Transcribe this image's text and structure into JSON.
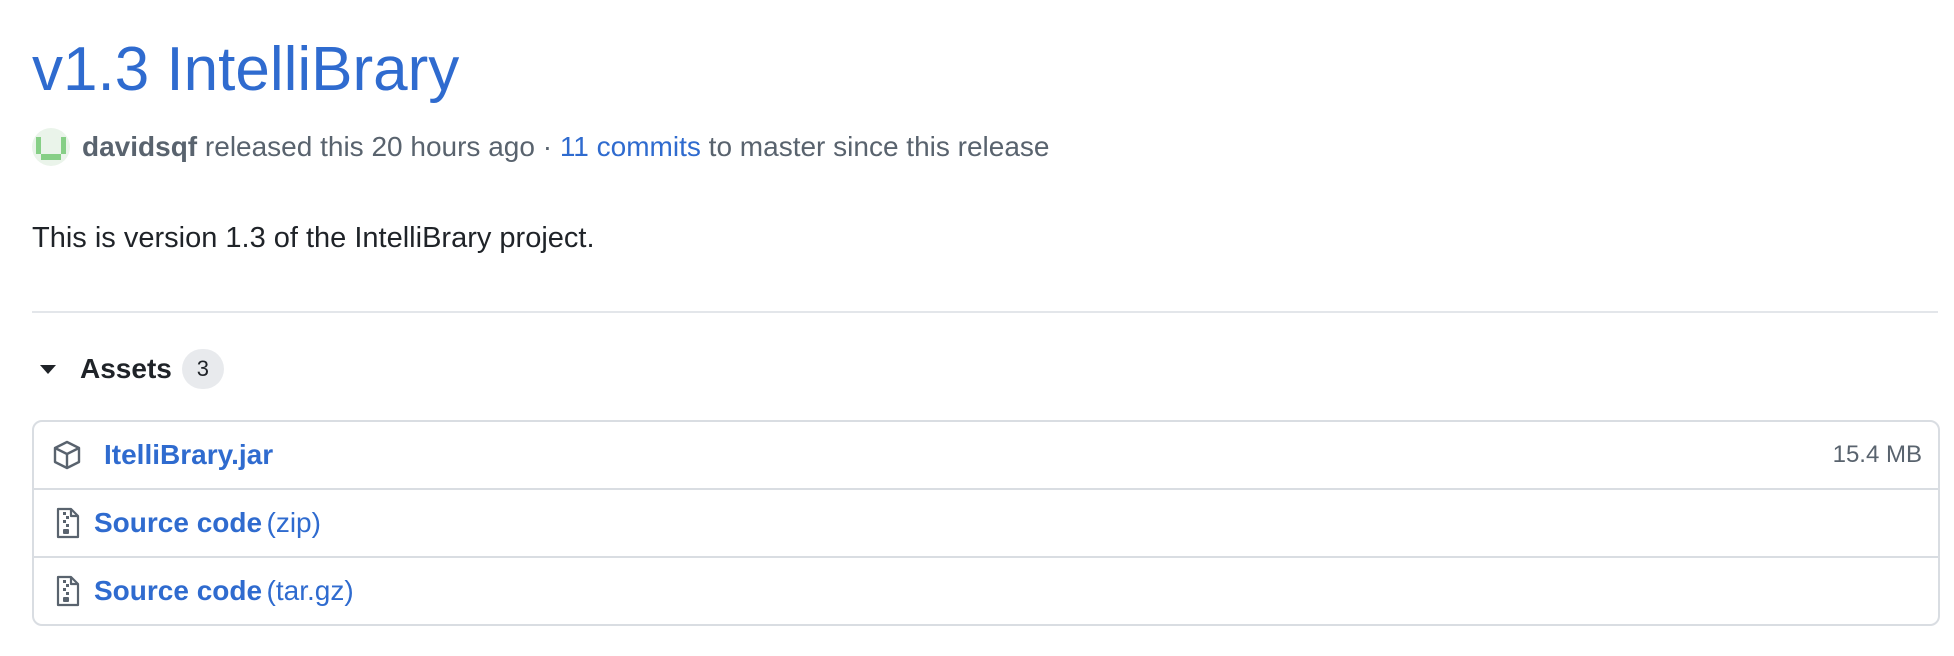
{
  "release": {
    "title": "v1.3 IntelliBrary",
    "author": "davidsqf",
    "released_text": "released this 20 hours ago",
    "separator": "·",
    "commits_link": "11 commits",
    "commits_suffix": "to master since this release",
    "description": "This is version 1.3 of the IntelliBrary project."
  },
  "assets": {
    "label": "Assets",
    "count": "3",
    "items": [
      {
        "icon": "package-icon",
        "name": "ItelliBrary.jar",
        "suffix": "",
        "size": "15.4 MB"
      },
      {
        "icon": "file-zip-icon",
        "name": "Source code",
        "suffix": "(zip)",
        "size": ""
      },
      {
        "icon": "file-zip-icon",
        "name": "Source code",
        "suffix": "(tar.gz)",
        "size": ""
      }
    ]
  },
  "colors": {
    "link": "#2f6bcf",
    "muted": "#59636e",
    "text": "#1f2328",
    "border": "#d9dde2"
  }
}
